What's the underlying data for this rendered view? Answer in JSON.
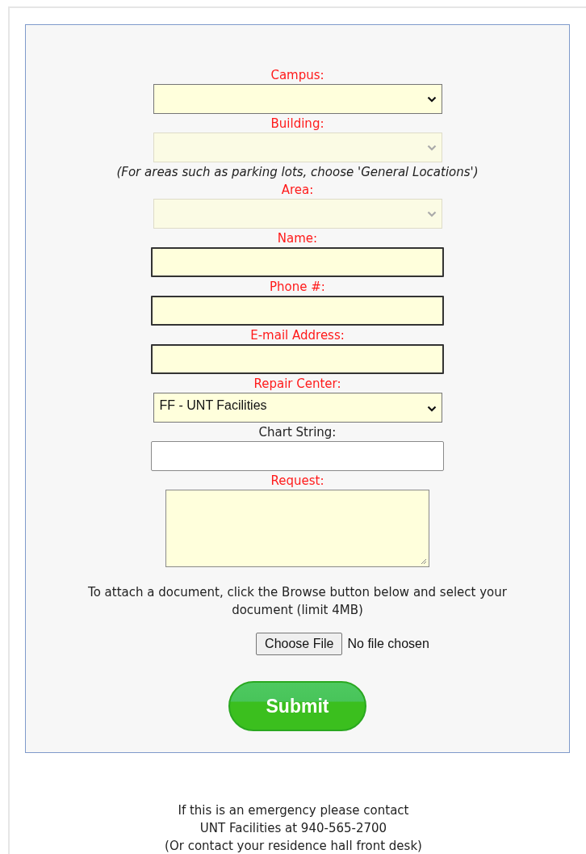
{
  "form": {
    "fields": [
      {
        "kind": "select",
        "label": "Campus:",
        "required": true,
        "disabled": false
      },
      {
        "kind": "select",
        "label": "Building:",
        "required": true,
        "disabled": true
      },
      {
        "kind": "note",
        "text": "(For areas such as parking lots, choose 'General Locations')"
      },
      {
        "kind": "select",
        "label": "Area:",
        "required": true,
        "disabled": true
      },
      {
        "kind": "text",
        "label": "Name:",
        "required": true
      },
      {
        "kind": "text",
        "label": "Phone #:",
        "required": true
      },
      {
        "kind": "text",
        "label": "E-mail Address:",
        "required": true
      },
      {
        "kind": "select",
        "label": "Repair Center:",
        "required": true,
        "disabled": false,
        "value": "FF - UNT Facilities"
      },
      {
        "kind": "text",
        "label": "Chart String:",
        "required": false
      },
      {
        "kind": "textarea",
        "label": "Request:",
        "required": true
      }
    ],
    "attach_note": "To attach a document, click the Browse button below and select your document (limit 4MB)",
    "file": {
      "button": "Choose File",
      "status": "No file chosen"
    },
    "submit": "Submit"
  },
  "footer": [
    "If this is an emergency please contact",
    "UNT Facilities at 940-565-2700",
    "(Or contact your residence hall front desk)"
  ]
}
